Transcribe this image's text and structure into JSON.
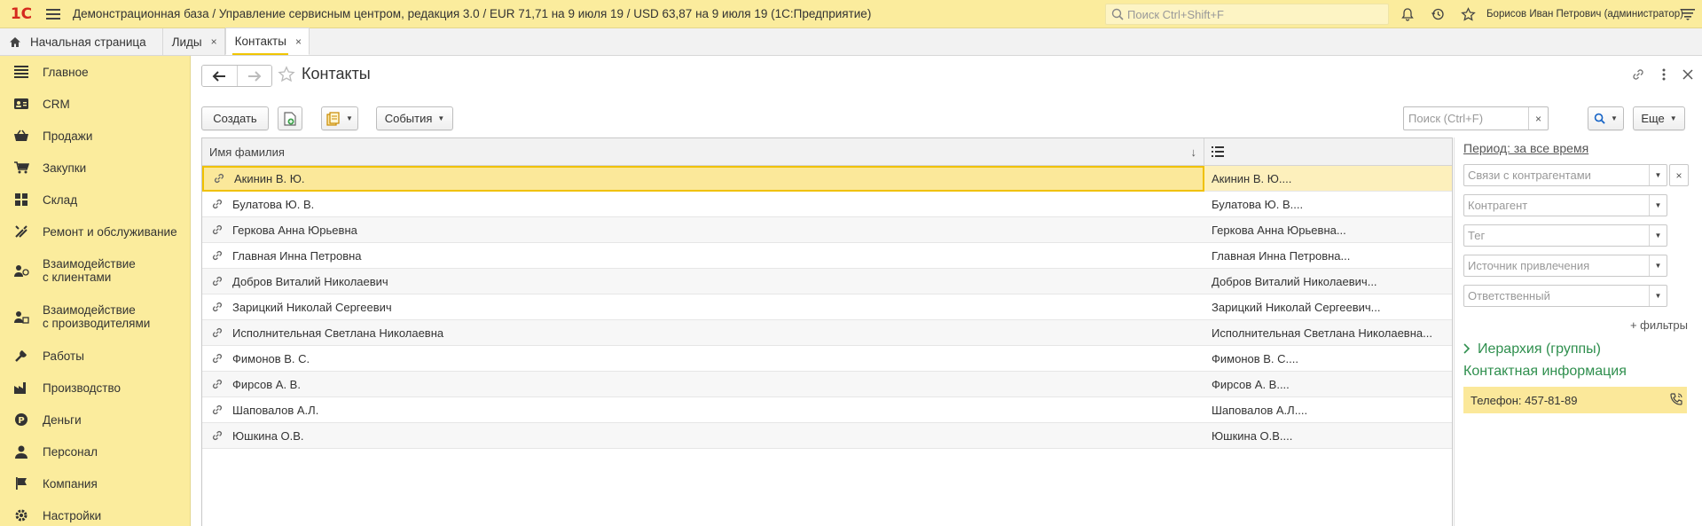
{
  "topbar": {
    "logo": "1C",
    "title": "Демонстрационная база / Управление сервисным центром, редакция 3.0 / EUR 71,71 на 9 июля 19 / USD 63,87 на 9 июля 19  (1С:Предприятие)",
    "search_placeholder": "Поиск Ctrl+Shift+F",
    "user": "Борисов Иван Петрович (администратор)"
  },
  "tabs": [
    {
      "label": "Начальная страница"
    },
    {
      "label": "Лиды",
      "close": "×"
    },
    {
      "label": "Контакты",
      "close": "×",
      "active": true
    }
  ],
  "sidebar": {
    "items": [
      {
        "label": "Главное",
        "icon": "menu-lines-icon"
      },
      {
        "label": "CRM",
        "icon": "crm-icon"
      },
      {
        "label": "Продажи",
        "icon": "basket-icon"
      },
      {
        "label": "Закупки",
        "icon": "cart-icon"
      },
      {
        "label": "Склад",
        "icon": "warehouse-icon"
      },
      {
        "label": "Ремонт и обслуживание",
        "icon": "tools-icon"
      },
      {
        "label": "Взаимодействие\nс клиентами",
        "icon": "client-interaction-icon"
      },
      {
        "label": "Взаимодействие\nс производителями",
        "icon": "manufacturer-interaction-icon"
      },
      {
        "label": "Работы",
        "icon": "works-icon"
      },
      {
        "label": "Производство",
        "icon": "factory-icon"
      },
      {
        "label": "Деньги",
        "icon": "money-icon"
      },
      {
        "label": "Персонал",
        "icon": "person-icon"
      },
      {
        "label": "Компания",
        "icon": "flag-icon"
      },
      {
        "label": "Настройки",
        "icon": "gear-icon"
      }
    ]
  },
  "page": {
    "title": "Контакты"
  },
  "toolbar": {
    "create_label": "Создать",
    "events_label": "События",
    "search_placeholder": "Поиск (Ctrl+F)",
    "search_clear": "×",
    "more_label": "Еще"
  },
  "table": {
    "headers": {
      "name": "Имя фамилия",
      "sort": "↓"
    },
    "rows": [
      {
        "name": "Акинин В. Ю.",
        "full": "Акинин В. Ю...."
      },
      {
        "name": "Булатова Ю. В.",
        "full": "Булатова Ю. В...."
      },
      {
        "name": "Геркова Анна Юрьевна",
        "full": "Геркова Анна Юрьевна..."
      },
      {
        "name": "Главная Инна Петровна",
        "full": "Главная Инна Петровна..."
      },
      {
        "name": "Добров Виталий Николаевич",
        "full": "Добров Виталий Николаевич..."
      },
      {
        "name": "Зарицкий Николай Сергеевич",
        "full": "Зарицкий Николай Сергеевич..."
      },
      {
        "name": "Исполнительная Светлана Николаевна",
        "full": "Исполнительная Светлана Николаевна..."
      },
      {
        "name": "Фимонов В. С.",
        "full": "Фимонов В. С...."
      },
      {
        "name": "Фирсов А. В.",
        "full": "Фирсов А. В...."
      },
      {
        "name": "Шаповалов А.Л.",
        "full": "Шаповалов А.Л...."
      },
      {
        "name": "Юшкина О.В.",
        "full": "Юшкина О.В...."
      }
    ]
  },
  "right_panel": {
    "period": "Период: за все время",
    "filters": [
      {
        "placeholder": "Связи с контрагентами",
        "clear": "×"
      },
      {
        "placeholder": "Контрагент"
      },
      {
        "placeholder": "Тег"
      },
      {
        "placeholder": "Источник привлечения"
      },
      {
        "placeholder": "Ответственный"
      }
    ],
    "more_filters": "+ фильтры",
    "hierarchy": "Иерархия (группы)",
    "contact_info_title": "Контактная информация",
    "phone": "Телефон: 457-81-89"
  },
  "colors": {
    "topbar_bg": "#fbec9d",
    "selected_row": "#fbe89a",
    "section_green": "#2f8f4e",
    "logo_red": "#d52b1e"
  }
}
